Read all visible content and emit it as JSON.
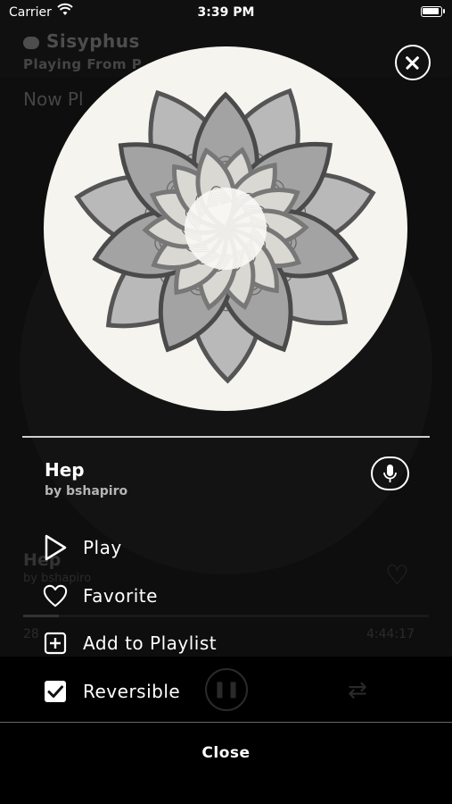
{
  "status_bar": {
    "carrier": "Carrier",
    "time": "3:39 PM"
  },
  "background": {
    "brand": "Sisyphus",
    "subtitle": "Playing From P",
    "section_title": "Now Pl",
    "track_title": "Hep",
    "track_author": "by bshapiro",
    "elapsed": "28",
    "duration": "4:44:17"
  },
  "track": {
    "title": "Hep",
    "author": "by bshapiro"
  },
  "menu": {
    "items": [
      {
        "label": "Play",
        "icon": "play-icon"
      },
      {
        "label": "Favorite",
        "icon": "heart-icon"
      },
      {
        "label": "Add to Playlist",
        "icon": "plus-box-icon"
      },
      {
        "label": "Reversible",
        "icon": "checkbox-checked-icon",
        "checked": true
      }
    ]
  },
  "close_label": "Close",
  "colors": {
    "accent": "#ffffff",
    "dim_background": "#1c1c1c"
  }
}
